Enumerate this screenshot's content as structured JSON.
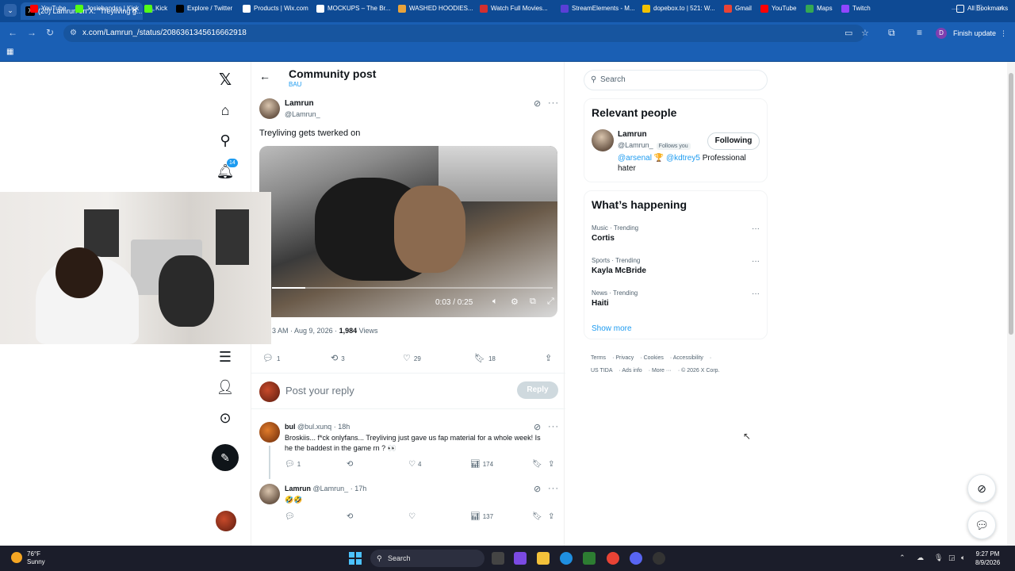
{
  "browser": {
    "tab_count_label": "(20)",
    "tab_title": "(20) Lamrun on X: \"Treyliving g...",
    "url": "x.com/Lamrun_/status/2086361345616662918",
    "finish_update": "Finish update",
    "profile_initial": "D",
    "bookmarks": [
      {
        "label": "YouTube",
        "color": "#ff0000"
      },
      {
        "label": "Josiebandss | Kick",
        "color": "#53fc18"
      },
      {
        "label": "Kick",
        "color": "#53fc18"
      },
      {
        "label": "Explore / Twitter",
        "color": "#000000"
      },
      {
        "label": "Products | Wix.com",
        "color": "#ffffff"
      },
      {
        "label": "MOCKUPS – The Br...",
        "color": "#ffffff"
      },
      {
        "label": "WASHED HOODIES...",
        "color": "#e8a33c"
      },
      {
        "label": "Watch Full Movies...",
        "color": "#d32f2f"
      },
      {
        "label": "StreamElements - M...",
        "color": "#5a3fd6"
      },
      {
        "label": "dopebox.to | 521: W...",
        "color": "#f2c200"
      },
      {
        "label": "Gmail",
        "color": "#ea4335"
      },
      {
        "label": "YouTube",
        "color": "#ff0000"
      },
      {
        "label": "Maps",
        "color": "#34a853"
      },
      {
        "label": "Twitch",
        "color": "#9146ff"
      }
    ],
    "all_bookmarks": "All Bookmarks"
  },
  "nav": {
    "notifications_badge": "14"
  },
  "header": {
    "title": "Community post",
    "subtitle": "BAU"
  },
  "post": {
    "author_name": "Lamrun",
    "author_handle": "@Lamrun_",
    "text": "Treyliving gets twerked on",
    "video_time": "0:03 / 0:25",
    "video_progress": 0.12,
    "time_partial": "3 AM",
    "date": "· Aug 9, 2026 ·",
    "views_count": "1,984",
    "views_label": "Views",
    "replies": "1",
    "reposts": "3",
    "likes": "29",
    "bookmarks": "18"
  },
  "reply_box": {
    "placeholder": "Post your reply",
    "button": "Reply"
  },
  "replies": [
    {
      "name": "bul",
      "handle": "@bul.xunq",
      "time": "· 18h",
      "text": "Broskiis... f*ck onlyfans... Treyliving just gave us fap material for a whole week! Is he the baddest in the game rn ? 👀",
      "replies": "1",
      "reposts": "",
      "likes": "4",
      "views": "174"
    },
    {
      "name": "Lamrun",
      "handle": "@Lamrun_",
      "time": "· 17h",
      "text": "🤣🤣",
      "replies": "",
      "reposts": "",
      "likes": "",
      "views": "137"
    }
  ],
  "sidebar": {
    "search_placeholder": "Search",
    "relevant_title": "Relevant people",
    "person": {
      "name": "Lamrun",
      "handle": "@Lamrun_",
      "follows_you": "Follows you",
      "follow_button": "Following",
      "bio_link1": "@arsenal",
      "bio_trophy": "🏆",
      "bio_link2": "@kdtrey5",
      "bio_text": "Professional hater"
    },
    "happening_title": "What’s happening",
    "trends": [
      {
        "category": "Music · Trending",
        "name": "Cortis"
      },
      {
        "category": "Sports · Trending",
        "name": "Kayla McBride"
      },
      {
        "category": "News · Trending",
        "name": "Haiti"
      }
    ],
    "show_more": "Show more",
    "footer": [
      "Terms",
      "Privacy",
      "Cookies",
      "Accessibility",
      "US TIDA",
      "Ads info",
      "More ···",
      "© 2026 X Corp."
    ]
  },
  "taskbar": {
    "temp": "76°F",
    "condition": "Sunny",
    "search": "Search",
    "time": "9:27 PM",
    "date": "8/9/2026"
  }
}
